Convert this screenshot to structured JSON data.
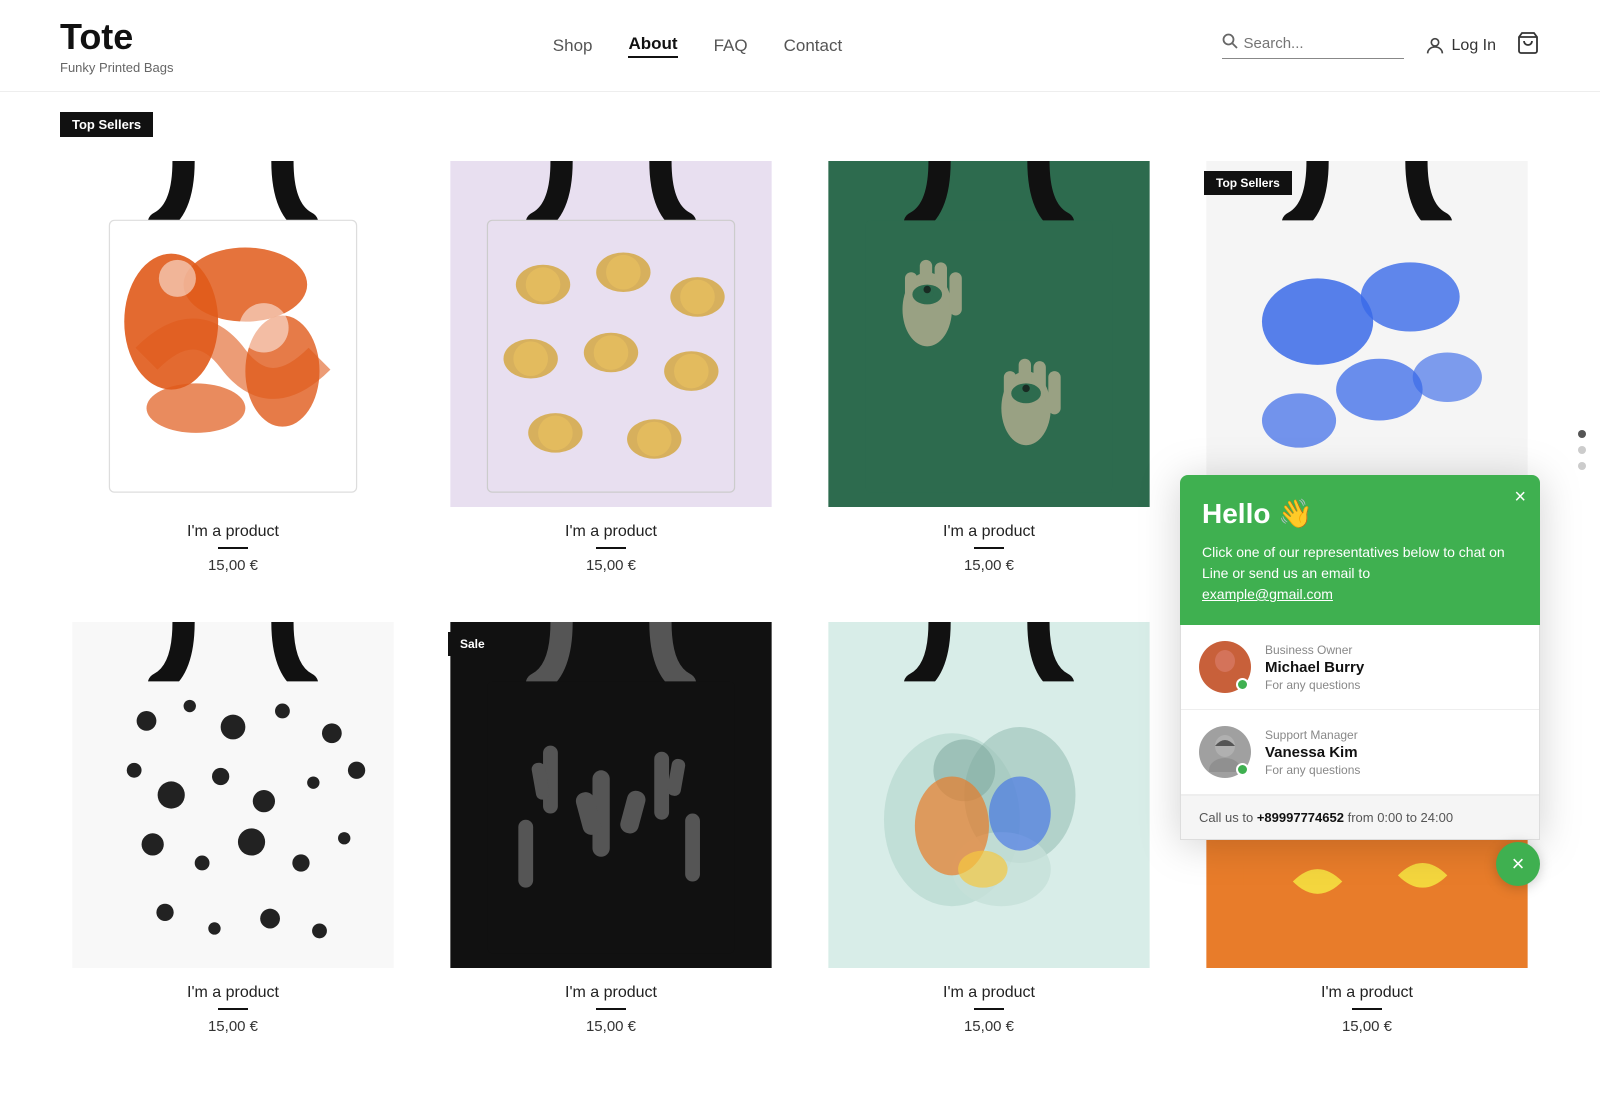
{
  "brand": {
    "title": "Tote",
    "subtitle": "Funky Printed Bags"
  },
  "nav": {
    "items": [
      {
        "label": "Shop",
        "active": false
      },
      {
        "label": "About",
        "active": true
      },
      {
        "label": "FAQ",
        "active": false
      },
      {
        "label": "Contact",
        "active": false
      }
    ]
  },
  "header": {
    "search_placeholder": "Search...",
    "login_label": "Log In",
    "cart_count": "0"
  },
  "sections": {
    "top_sellers_label": "Top Sellers",
    "sale_label": "Sale"
  },
  "products_row1": [
    {
      "name": "I'm a product",
      "price": "15,00 €",
      "style": "orange",
      "badge": "Top Sellers"
    },
    {
      "name": "I'm a product",
      "price": "15,00 €",
      "style": "lavender",
      "badge": ""
    },
    {
      "name": "I'm a product",
      "price": "15,00 €",
      "style": "green",
      "badge": ""
    },
    {
      "name": "I'm a product",
      "price": "15,00 €",
      "style": "blue",
      "badge": "Top Sellers"
    }
  ],
  "products_row2": [
    {
      "name": "I'm a product",
      "price": "15,00 €",
      "style": "dots",
      "badge": ""
    },
    {
      "name": "I'm a product",
      "price": "15,00 €",
      "style": "cactus",
      "badge": "Sale"
    },
    {
      "name": "I'm a product",
      "price": "15,00 €",
      "style": "abstract",
      "badge": ""
    },
    {
      "name": "I'm a product",
      "price": "15,00 €",
      "style": "banana",
      "badge": ""
    }
  ],
  "chat": {
    "hello": "Hello 👋",
    "description": "Click one of our representatives below to chat on Line or send us an email to",
    "email": "example@gmail.com",
    "close_x": "×",
    "agents": [
      {
        "role": "Business Owner",
        "name": "Michael Burry",
        "tagline": "For any questions",
        "avatar_style": "orange"
      },
      {
        "role": "Support Manager",
        "name": "Vanessa Kim",
        "tagline": "For any questions",
        "avatar_style": "gray"
      }
    ],
    "footer_text": "Call us to",
    "phone": "+89997774652",
    "hours": "from 0:00 to 24:00",
    "close_circle": "×"
  }
}
